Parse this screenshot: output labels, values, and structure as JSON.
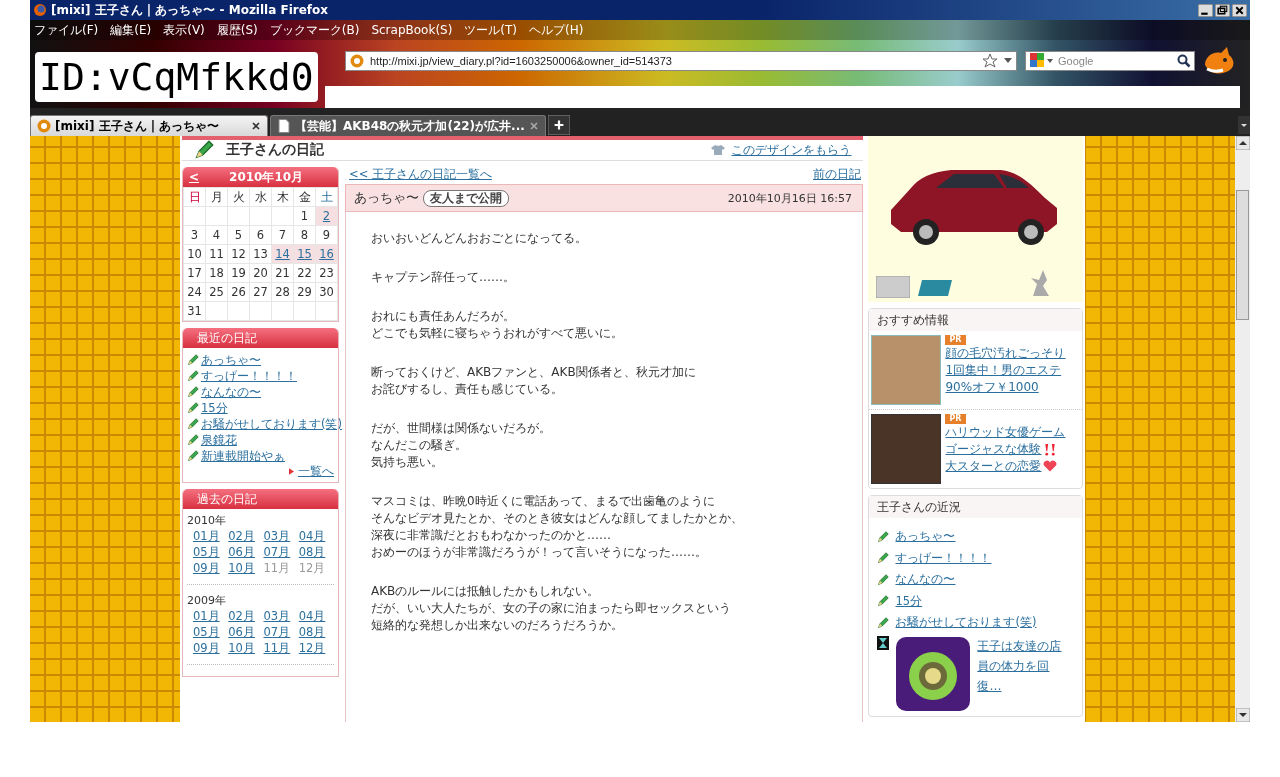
{
  "window": {
    "title": "[mixi] 王子さん | あっちゃ〜 - Mozilla Firefox"
  },
  "menu": [
    "ファイル(F)",
    "編集(E)",
    "表示(V)",
    "履歴(S)",
    "ブックマーク(B)",
    "ScrapBook(S)",
    "ツール(T)",
    "ヘルプ(H)"
  ],
  "id_label": "ID:vCqMfkkd0",
  "address_bar": {
    "url": "http://mixi.jp/view_diary.pl?id=1603250006&owner_id=514373"
  },
  "search_box": {
    "placeholder": "Google"
  },
  "tabs": [
    {
      "label": "[mixi] 王子さん | あっちゃ〜",
      "selected": true
    },
    {
      "label": "【芸能】AKB48の秋元才加(22)が広井...",
      "selected": false
    }
  ],
  "diary_header": {
    "title": "王子さんの日記",
    "design_link": "このデザインをもらう"
  },
  "calendar": {
    "prev": "<",
    "month": "2010年10月",
    "weekdays": [
      "日",
      "月",
      "火",
      "水",
      "木",
      "金",
      "土"
    ],
    "weeks": [
      {
        "cells": [
          {
            "has_entry": false
          },
          {
            "has_entry": false
          },
          {
            "has_entry": false
          },
          {
            "has_entry": false
          },
          {
            "has_entry": false
          },
          {
            "day": "1",
            "has_entry": false
          },
          {
            "day": "2",
            "has_entry": true
          }
        ]
      },
      {
        "cells": [
          {
            "day": "3",
            "has_entry": false
          },
          {
            "day": "4",
            "has_entry": false
          },
          {
            "day": "5",
            "has_entry": false
          },
          {
            "day": "6",
            "has_entry": false
          },
          {
            "day": "7",
            "has_entry": false
          },
          {
            "day": "8",
            "has_entry": false
          },
          {
            "day": "9",
            "has_entry": false
          }
        ]
      },
      {
        "cells": [
          {
            "day": "10",
            "has_entry": false
          },
          {
            "day": "11",
            "has_entry": false
          },
          {
            "day": "12",
            "has_entry": false
          },
          {
            "day": "13",
            "has_entry": false
          },
          {
            "day": "14",
            "has_entry": true
          },
          {
            "day": "15",
            "has_entry": true
          },
          {
            "day": "16",
            "has_entry": true
          }
        ]
      },
      {
        "cells": [
          {
            "day": "17",
            "has_entry": false
          },
          {
            "day": "18",
            "has_entry": false
          },
          {
            "day": "19",
            "has_entry": false
          },
          {
            "day": "20",
            "has_entry": false
          },
          {
            "day": "21",
            "has_entry": false
          },
          {
            "day": "22",
            "has_entry": false
          },
          {
            "day": "23",
            "has_entry": false
          }
        ]
      },
      {
        "cells": [
          {
            "day": "24",
            "has_entry": false
          },
          {
            "day": "25",
            "has_entry": false
          },
          {
            "day": "26",
            "has_entry": false
          },
          {
            "day": "27",
            "has_entry": false
          },
          {
            "day": "28",
            "has_entry": false
          },
          {
            "day": "29",
            "has_entry": false
          },
          {
            "day": "30",
            "has_entry": false
          }
        ]
      },
      {
        "cells": [
          {
            "day": "31",
            "has_entry": false
          },
          {
            "has_entry": false
          },
          {
            "has_entry": false
          },
          {
            "has_entry": false
          },
          {
            "has_entry": false
          },
          {
            "has_entry": false
          },
          {
            "has_entry": false
          }
        ]
      }
    ]
  },
  "recent_diary": {
    "title": "最近の日記",
    "items": [
      "あっちゃ〜",
      "すっげー！！！！",
      "なんなの〜",
      "15分",
      "お騒がせしております(笑)",
      "泉鏡花",
      "新連載開始やぁ"
    ],
    "more": "一覧へ"
  },
  "past_diary": {
    "title": "過去の日記",
    "years": [
      {
        "year": "2010年",
        "months": [
          {
            "label": "01月",
            "linked": true
          },
          {
            "label": "02月",
            "linked": true
          },
          {
            "label": "03月",
            "linked": true
          },
          {
            "label": "04月",
            "linked": true
          },
          {
            "label": "05月",
            "linked": true
          },
          {
            "label": "06月",
            "linked": true
          },
          {
            "label": "07月",
            "linked": true
          },
          {
            "label": "08月",
            "linked": true
          },
          {
            "label": "09月",
            "linked": true
          },
          {
            "label": "10月",
            "linked": true
          },
          {
            "label": "11月",
            "linked": false
          },
          {
            "label": "12月",
            "linked": false
          }
        ]
      },
      {
        "year": "2009年",
        "months": [
          {
            "label": "01月",
            "linked": true
          },
          {
            "label": "02月",
            "linked": true
          },
          {
            "label": "03月",
            "linked": true
          },
          {
            "label": "04月",
            "linked": true
          },
          {
            "label": "05月",
            "linked": true
          },
          {
            "label": "06月",
            "linked": true
          },
          {
            "label": "07月",
            "linked": true
          },
          {
            "label": "08月",
            "linked": true
          },
          {
            "label": "09月",
            "linked": true
          },
          {
            "label": "10月",
            "linked": true
          },
          {
            "label": "11月",
            "linked": true
          },
          {
            "label": "12月",
            "linked": true
          }
        ]
      }
    ]
  },
  "entry_nav": {
    "back": "<< 王子さんの日記一覧へ",
    "prev": "前の日記"
  },
  "entry": {
    "title": "あっちゃ〜",
    "visibility": "友人まで公開",
    "date": "2010年10月16日 16:57",
    "paragraphs": [
      {
        "lines": [
          "おいおいどんどんおおごとになってる。"
        ]
      },
      {
        "lines": [
          "キャプテン辞任って……。"
        ]
      },
      {
        "lines": [
          "おれにも責任あんだろが。",
          "どこでも気軽に寝ちゃうおれがすべて悪いに。"
        ]
      },
      {
        "lines": [
          "断っておくけど、AKBファンと、AKB関係者と、秋元才加に",
          "お詫びするし、責任も感じている。"
        ]
      },
      {
        "lines": [
          "だが、世間様は関係ないだろが。",
          "なんだこの騒ぎ。",
          "気持ち悪い。"
        ]
      },
      {
        "lines": [
          "マスコミは、昨晩0時近くに電話あって、まるで出歯亀のように",
          "そんなビデオ見たとか、そのとき彼女はどんな顔してましたかとか、",
          "深夜に非常識だとおもわなかったのかと……",
          "おめーのほうが非常識だろうが！って言いそうになった……。"
        ]
      },
      {
        "lines": [
          "AKBのルールには抵触したかもしれない。",
          "だが、いい大人たちが、女の子の家に泊まったら即セックスという",
          "短絡的な発想しか出来ないのだろうだろうか。"
        ]
      }
    ]
  },
  "recommend": {
    "title": "おすすめ情報",
    "items": [
      {
        "badge": "PR",
        "lines": [
          {
            "text": "顔の毛穴汚れごっそり",
            "kind": "plain"
          },
          {
            "text": "1回集中！男のエステ",
            "kind": "plain"
          },
          {
            "text": "90%オフ￥1000",
            "kind": "plain"
          }
        ]
      },
      {
        "badge": "PR",
        "lines": [
          {
            "text": "ハリウッド女優ゲーム",
            "kind": "plain"
          },
          {
            "text": "ゴージャスな体験",
            "kind": "exclaim"
          },
          {
            "text": "大スターとの恋愛",
            "kind": "heart"
          }
        ]
      }
    ]
  },
  "status": {
    "title": "王子さんの近況",
    "items": [
      "あっちゃ〜",
      "すっげー！！！！",
      "なんなの〜",
      "15分",
      "お騒がせしております(笑)"
    ],
    "app": {
      "lines": [
        "王子は友達の店",
        "員の体力を回",
        "復…"
      ]
    }
  }
}
